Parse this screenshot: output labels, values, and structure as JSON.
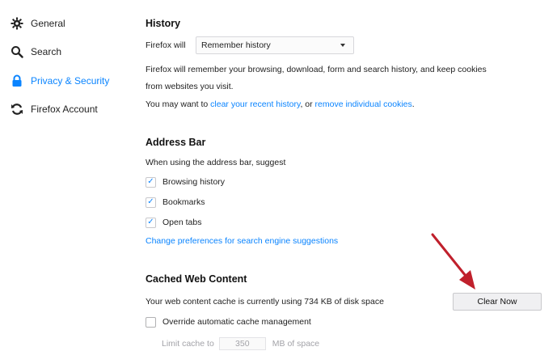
{
  "sidebar": {
    "items": [
      {
        "label": "General",
        "icon": "gear-icon"
      },
      {
        "label": "Search",
        "icon": "search-icon"
      },
      {
        "label": "Privacy & Security",
        "icon": "lock-icon",
        "active": true
      },
      {
        "label": "Firefox Account",
        "icon": "sync-icon"
      }
    ]
  },
  "history": {
    "title": "History",
    "firefox_will_label": "Firefox will",
    "mode_selected": "Remember history",
    "desc_line1": "Firefox will remember your browsing, download, form and search history, and keep cookies",
    "desc_line2": "from websites you visit.",
    "may_want_prefix": "You may want to ",
    "clear_link": "clear your recent history",
    "or_text": ", or ",
    "remove_link": "remove individual cookies",
    "period": "."
  },
  "address_bar": {
    "title": "Address Bar",
    "suggest_label": "When using the address bar, suggest",
    "options": [
      {
        "label": "Browsing history",
        "checked": true
      },
      {
        "label": "Bookmarks",
        "checked": true
      },
      {
        "label": "Open tabs",
        "checked": true
      }
    ],
    "prefs_link": "Change preferences for search engine suggestions"
  },
  "cache": {
    "title": "Cached Web Content",
    "usage_text": "Your web content cache is currently using 734 KB of disk space",
    "clear_button": "Clear Now",
    "override_label": "Override automatic cache management",
    "override_checked": false,
    "limit_label": "Limit cache to",
    "limit_value": "350",
    "limit_unit": "MB of space"
  },
  "colors": {
    "accent": "#0a84ff",
    "annotation_arrow": "#c0202c"
  }
}
